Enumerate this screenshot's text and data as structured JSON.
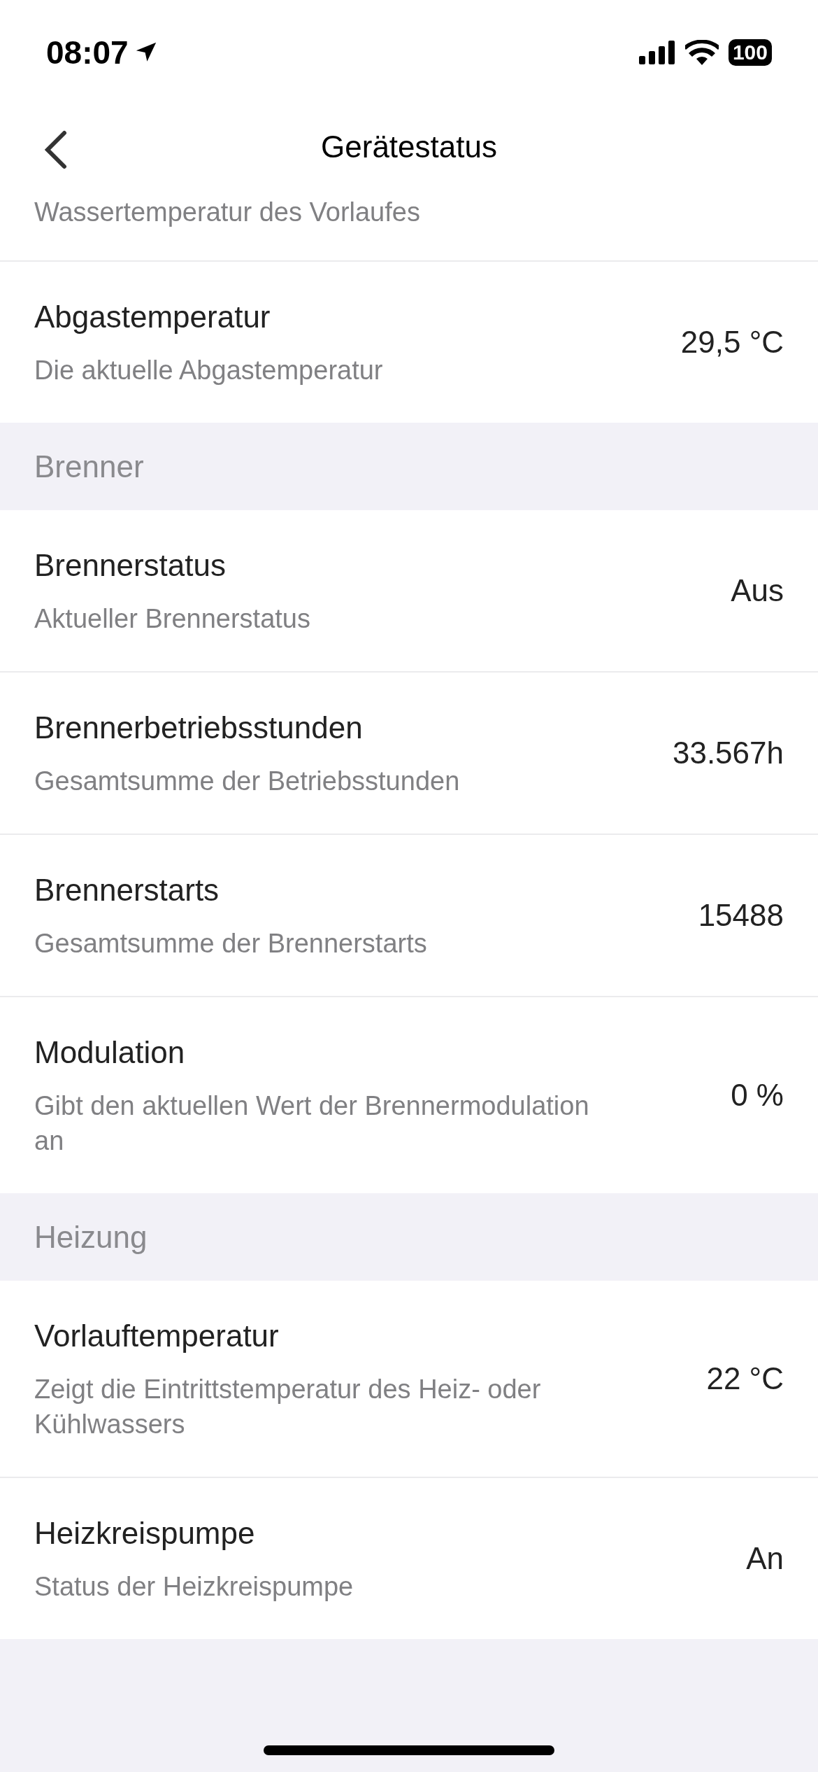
{
  "status_bar": {
    "time": "08:07",
    "battery": "100"
  },
  "nav": {
    "title": "Gerätestatus"
  },
  "groups": [
    {
      "rows": [
        {
          "description": "Wassertemperatur des Vorlaufes"
        },
        {
          "title": "Abgastemperatur",
          "description": "Die aktuelle Abgastemperatur",
          "value": "29,5 °C"
        }
      ]
    },
    {
      "header": "Brenner",
      "rows": [
        {
          "title": "Brennerstatus",
          "description": "Aktueller Brennerstatus",
          "value": "Aus"
        },
        {
          "title": "Brennerbetriebsstunden",
          "description": "Gesamtsumme der Betriebsstunden",
          "value": "33.567h"
        },
        {
          "title": "Brennerstarts",
          "description": "Gesamtsumme der Brennerstarts",
          "value": "15488"
        },
        {
          "title": "Modulation",
          "description": "Gibt den aktuellen Wert der Brennermodulation an",
          "value": "0 %"
        }
      ]
    },
    {
      "header": "Heizung",
      "rows": [
        {
          "title": "Vorlauftemperatur",
          "description": "Zeigt die Eintrittstemperatur des Heiz- oder Kühlwassers",
          "value": "22 °C"
        },
        {
          "title": "Heizkreispumpe",
          "description": "Status der Heizkreispumpe",
          "value": "An"
        }
      ]
    }
  ]
}
